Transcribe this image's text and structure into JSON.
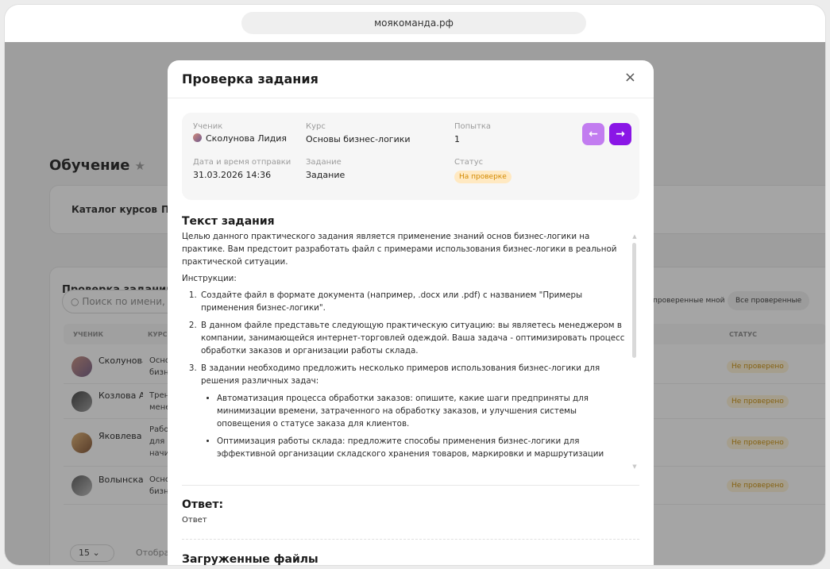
{
  "browser": {
    "url": "моякоманда.рф"
  },
  "background": {
    "page_title": "Обучение",
    "tabs": [
      "Каталог курсов",
      "П"
    ],
    "section_title": "Проверка заданий",
    "search_placeholder": "Поиск по имени, ф",
    "filters": [
      "проверенные мной",
      "Все проверенные"
    ],
    "columns": [
      "УЧЕНИК",
      "КУРС",
      "СТАТУС"
    ],
    "rows": [
      {
        "name": "Сколунова Лидия",
        "course": "Основы бизнес",
        "status": "Не проверено"
      },
      {
        "name": "Козлова Алина",
        "course": "Тренинг менеджеров",
        "status": "Не проверено"
      },
      {
        "name": "Яковлева Елена",
        "course": "Работа для начинающих",
        "status": "Не проверено"
      },
      {
        "name": "Волынская Вероника",
        "course": "Основы бизнес",
        "status": "Не проверено"
      }
    ],
    "page_size": "15",
    "pagination_text": "Отобра"
  },
  "modal": {
    "title": "Проверка задания",
    "close": "×",
    "info": {
      "student_label": "Ученик",
      "student_value": "Сколунова Лидия",
      "course_label": "Курс",
      "course_value": "Основы бизнес-логики",
      "attempt_label": "Попытка",
      "attempt_value": "1",
      "datetime_label": "Дата и время отправки",
      "datetime_value": "31.03.2026 14:36",
      "task_label": "Задание",
      "task_value": "Задание",
      "status_label": "Статус",
      "status_value": "На проверке"
    },
    "nav": {
      "prev": "←",
      "next": "→"
    },
    "task_section_title": "Текст задания",
    "task": {
      "intro": "Целью данного практического задания является применение знаний основ бизнес-логики на практике. Вам предстоит разработать файл с примерами использования бизнес-логики в реальной практической ситуации.",
      "instructions_label": "Инструкции:",
      "step1": "Создайте файл в формате документа (например, .docx или .pdf) с названием \"Примеры применения бизнес-логики\".",
      "step2": "В данном файле представьте следующую практическую ситуацию: вы являетесь менеджером в компании, занимающейся интернет-торговлей одеждой. Ваша задача - оптимизировать процесс обработки заказов и организации работы склада.",
      "step3": "В задании необходимо предложить несколько примеров использования бизнес-логики для решения различных задач:",
      "sub1": "Автоматизация процесса обработки заказов: опишите, какие шаги предприняты для минимизации времени, затраченного на обработку заказов, и улучшения системы оповещения о статусе заказа для клиентов.",
      "sub2": "Оптимизация работы склада: предложите способы применения бизнес-логики для эффективной организации складского хранения товаров, маркировки и маршрутизации"
    },
    "answer_section_title": "Ответ:",
    "answer_text": "Ответ",
    "files_section_title": "Загруженные файлы"
  }
}
